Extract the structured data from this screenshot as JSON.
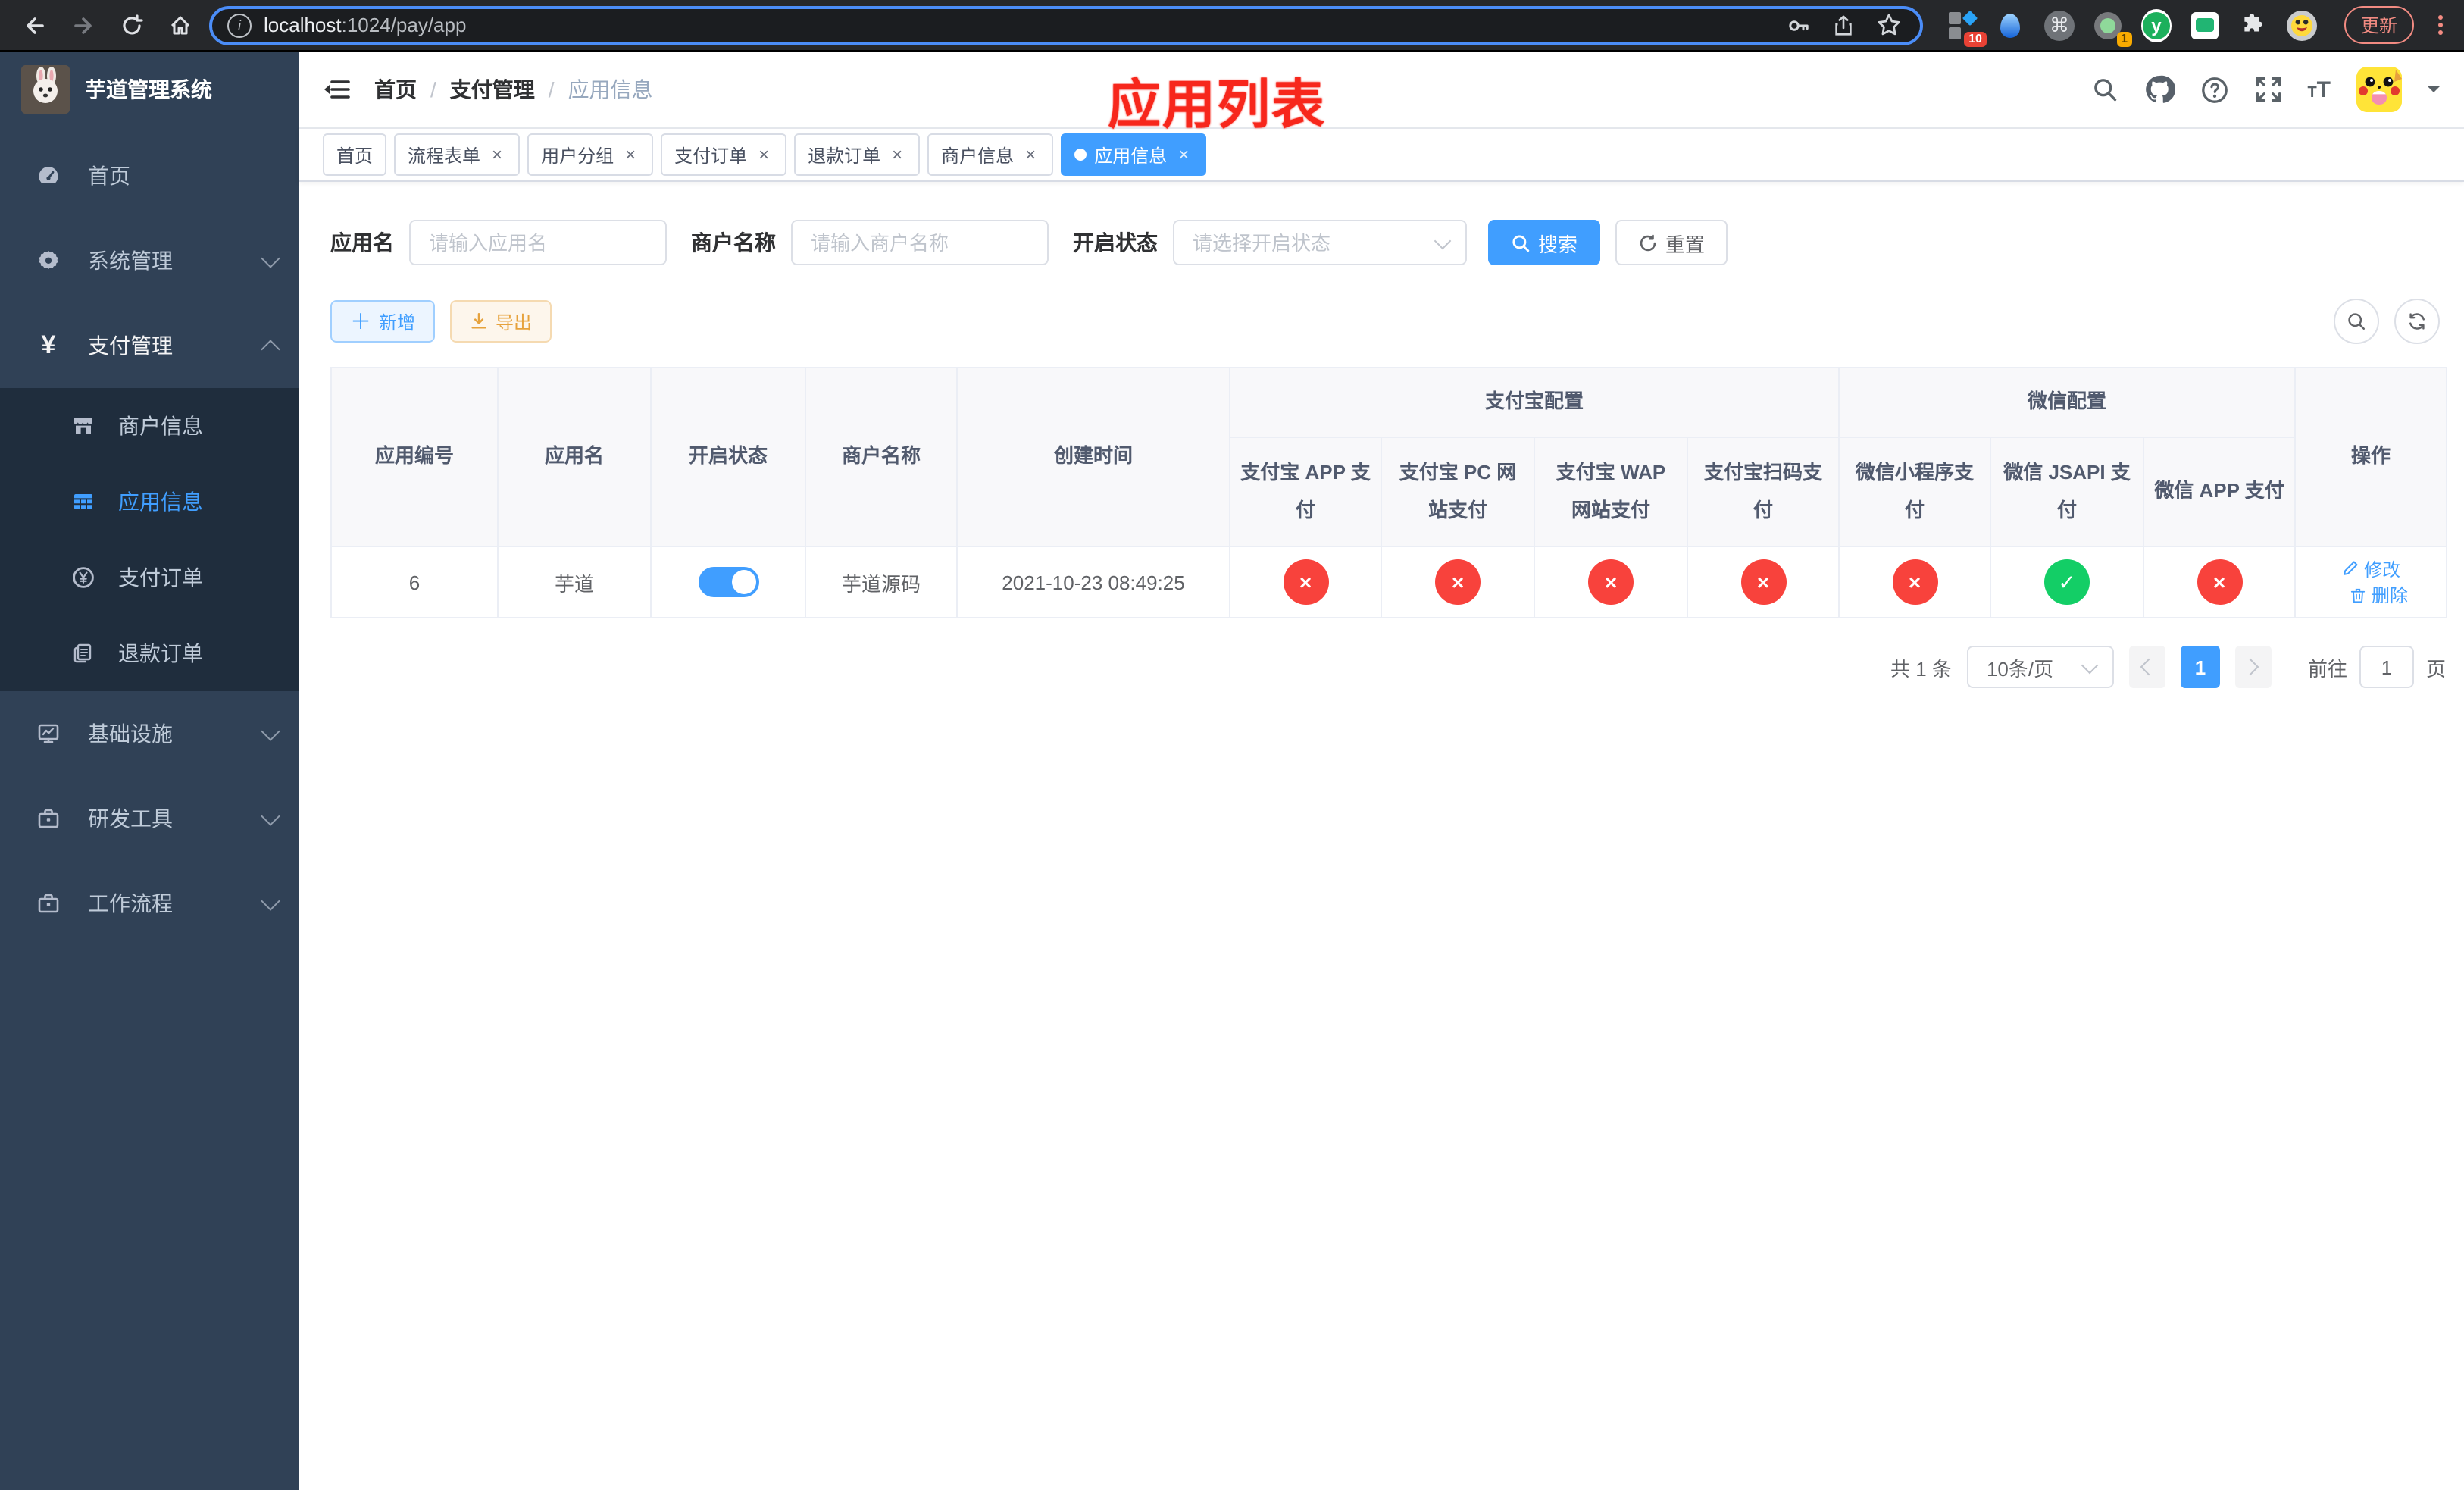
{
  "browser": {
    "url_host": "localhost",
    "url_rest": ":1024/pay/app",
    "update_label": "更新",
    "extension_badge_grid": "10",
    "extension_badge_recorder": "1",
    "extension_y_letter": "y",
    "command_glyph": "⌘"
  },
  "sidebar": {
    "title": "芋道管理系统",
    "items": [
      {
        "label": "首页",
        "icon": "dashboard-icon"
      },
      {
        "label": "系统管理",
        "icon": "gear-icon",
        "state": "collapsed"
      },
      {
        "label": "支付管理",
        "icon": "yen-icon",
        "state": "expanded",
        "active": true
      },
      {
        "label": "基础设施",
        "icon": "monitor-icon",
        "state": "collapsed"
      },
      {
        "label": "研发工具",
        "icon": "toolbox-icon",
        "state": "collapsed"
      },
      {
        "label": "工作流程",
        "icon": "toolbox-icon",
        "state": "collapsed"
      }
    ],
    "payment_children": [
      {
        "label": "商户信息",
        "icon": "shop-icon",
        "active": false
      },
      {
        "label": "应用信息",
        "icon": "grid-icon",
        "active": true
      },
      {
        "label": "支付订单",
        "icon": "yen-circle-icon",
        "active": false
      },
      {
        "label": "退款订单",
        "icon": "document-icon",
        "active": false
      }
    ]
  },
  "navbar": {
    "breadcrumb": [
      "首页",
      "支付管理",
      "应用信息"
    ]
  },
  "annotation": {
    "text": "应用列表",
    "color": "#f7271c"
  },
  "tabs": [
    {
      "label": "首页",
      "closable": false,
      "active": false
    },
    {
      "label": "流程表单",
      "closable": true,
      "active": false
    },
    {
      "label": "用户分组",
      "closable": true,
      "active": false
    },
    {
      "label": "支付订单",
      "closable": true,
      "active": false
    },
    {
      "label": "退款订单",
      "closable": true,
      "active": false
    },
    {
      "label": "商户信息",
      "closable": true,
      "active": false
    },
    {
      "label": "应用信息",
      "closable": true,
      "active": true
    }
  ],
  "filters": {
    "app_name_label": "应用名",
    "app_name_placeholder": "请输入应用名",
    "merchant_label": "商户名称",
    "merchant_placeholder": "请输入商户名称",
    "status_label": "开启状态",
    "status_placeholder": "请选择开启状态",
    "search_label": "搜索",
    "reset_label": "重置"
  },
  "toolbar": {
    "add_label": "新增",
    "export_label": "导出"
  },
  "table": {
    "columns": [
      "应用编号",
      "应用名",
      "开启状态",
      "商户名称",
      "创建时间"
    ],
    "groups": [
      {
        "label": "支付宝配置",
        "children": [
          "支付宝 APP 支付",
          "支付宝 PC 网站支付",
          "支付宝 WAP 网站支付",
          "支付宝扫码支付"
        ]
      },
      {
        "label": "微信配置",
        "children": [
          "微信小程序支付",
          "微信 JSAPI 支付",
          "微信 APP 支付"
        ]
      }
    ],
    "ops_label": "操作",
    "rows": [
      {
        "id": "6",
        "name": "芋道",
        "enabled": true,
        "merchant": "芋道源码",
        "created": "2021-10-23 08:49:25",
        "statuses": [
          "×",
          "×",
          "×",
          "×",
          "×",
          "✓",
          "×"
        ],
        "edit_label": "修改",
        "delete_label": "删除"
      }
    ]
  },
  "pagination": {
    "total": "共 1 条",
    "page_size": "10条/页",
    "current_page": "1",
    "goto_label": "前往",
    "goto_value": "1",
    "page_suffix": "页"
  },
  "colors": {
    "accent": "#409eff",
    "success": "#13ce66",
    "danger": "#f8423c",
    "warning": "#e6a23c",
    "sidebar_bg": "#304156",
    "submenu_bg": "#1f2d3d",
    "annotation": "#f7271c",
    "chrome_bg": "#26282b",
    "omnibox_focus_border": "#4b8df8"
  }
}
